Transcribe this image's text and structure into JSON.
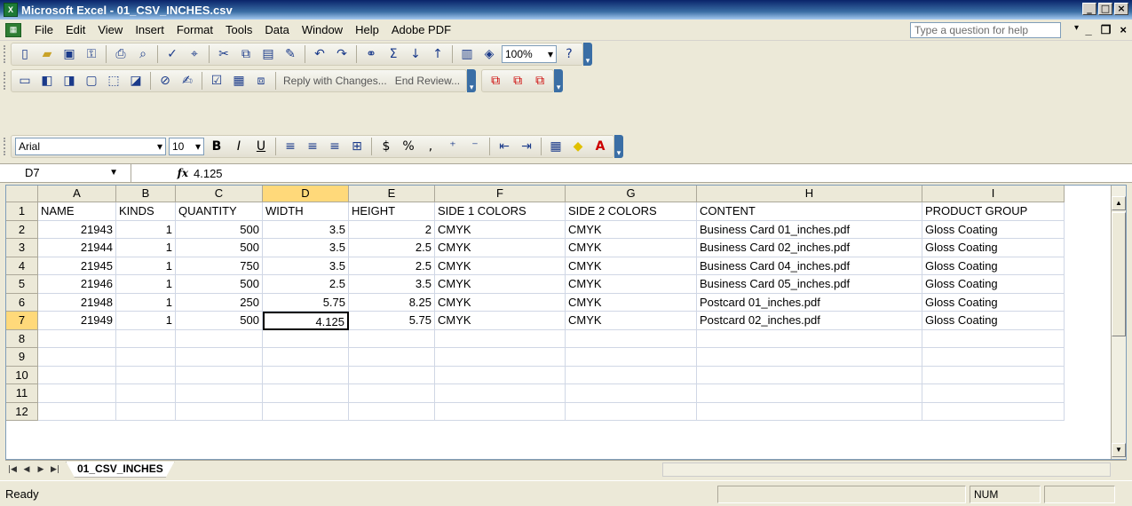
{
  "window": {
    "title": "Microsoft Excel - 01_CSV_INCHES.csv",
    "min": "_",
    "max": "□",
    "close": "×"
  },
  "menu": {
    "items": [
      "File",
      "Edit",
      "View",
      "Insert",
      "Format",
      "Tools",
      "Data",
      "Window",
      "Help",
      "Adobe PDF"
    ],
    "help_placeholder": "Type a question for help"
  },
  "toolbar_standard": {
    "zoom": "100%"
  },
  "toolbar_review": {
    "reply_label": "Reply with Changes...",
    "end_review_label": "End Review..."
  },
  "toolbar_format": {
    "font": "Arial",
    "size": "10"
  },
  "formula_bar": {
    "name_box": "D7",
    "fx": "fx",
    "value": "4.125"
  },
  "columns": [
    "A",
    "B",
    "C",
    "D",
    "E",
    "F",
    "G",
    "H",
    "I"
  ],
  "rows": [
    [
      "NAME",
      "KINDS",
      "QUANTITY",
      "WIDTH",
      "HEIGHT",
      "SIDE 1 COLORS",
      "SIDE 2 COLORS",
      "CONTENT",
      "PRODUCT GROUP"
    ],
    [
      "21943",
      "1",
      "500",
      "3.5",
      "2",
      "CMYK",
      "CMYK",
      "Business Card 01_inches.pdf",
      "Gloss Coating"
    ],
    [
      "21944",
      "1",
      "500",
      "3.5",
      "2.5",
      "CMYK",
      "CMYK",
      "Business Card 02_inches.pdf",
      "Gloss Coating"
    ],
    [
      "21945",
      "1",
      "750",
      "3.5",
      "2.5",
      "CMYK",
      "CMYK",
      "Business Card 04_inches.pdf",
      "Gloss Coating"
    ],
    [
      "21946",
      "1",
      "500",
      "2.5",
      "3.5",
      "CMYK",
      "CMYK",
      "Business Card 05_inches.pdf",
      "Gloss Coating"
    ],
    [
      "21948",
      "1",
      "250",
      "5.75",
      "8.25",
      "CMYK",
      "CMYK",
      "Postcard 01_inches.pdf",
      "Gloss Coating"
    ],
    [
      "21949",
      "1",
      "500",
      "4.125",
      "5.75",
      "CMYK",
      "CMYK",
      "Postcard 02_inches.pdf",
      "Gloss Coating"
    ],
    [
      "",
      "",
      "",
      "",
      "",
      "",
      "",
      "",
      ""
    ],
    [
      "",
      "",
      "",
      "",
      "",
      "",
      "",
      "",
      ""
    ],
    [
      "",
      "",
      "",
      "",
      "",
      "",
      "",
      "",
      ""
    ],
    [
      "",
      "",
      "",
      "",
      "",
      "",
      "",
      "",
      ""
    ],
    [
      "",
      "",
      "",
      "",
      "",
      "",
      "",
      "",
      ""
    ]
  ],
  "row_numbers": [
    "1",
    "2",
    "3",
    "4",
    "5",
    "6",
    "7",
    "8",
    "9",
    "10",
    "11",
    "12"
  ],
  "sheet_tab": "01_CSV_INCHES",
  "status": {
    "left": "Ready",
    "num": "NUM"
  }
}
